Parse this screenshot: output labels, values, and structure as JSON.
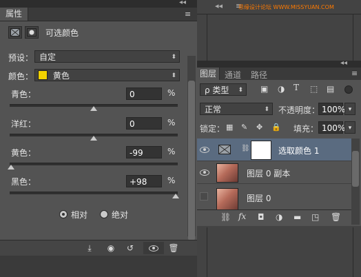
{
  "properties_panel": {
    "tab_label": "属性",
    "title": "可选颜色",
    "preset_label": "预设：",
    "preset_value": "自定",
    "colors_label": "颜色：",
    "colors_value": "黄色",
    "colors_swatch": "#f2d200",
    "sliders": [
      {
        "label": "青色：",
        "value": "0",
        "unit": "%"
      },
      {
        "label": "洋红：",
        "value": "0",
        "unit": "%"
      },
      {
        "label": "黄色：",
        "value": "-99",
        "unit": "%"
      },
      {
        "label": "黑色：",
        "value": "+98",
        "unit": "%"
      }
    ],
    "method": {
      "relative_label": "相对",
      "absolute_label": "绝对",
      "selected": "relative"
    }
  },
  "layers_panel": {
    "tabs": [
      "图层",
      "通道",
      "路径"
    ],
    "kind_filter": "ρ 类型",
    "blend_mode": "正常",
    "opacity_label": "不透明度：",
    "opacity_value": "100%",
    "lock_label": "锁定：",
    "fill_label": "填充：",
    "fill_value": "100%",
    "layers": [
      {
        "name": "选取颜色 1",
        "selected": true
      },
      {
        "name": "图层 0 副本",
        "selected": false
      },
      {
        "name": "图层 0",
        "selected": false
      }
    ]
  },
  "watermark": "思缘设计论坛 WWW.MISSYUAN.COM"
}
